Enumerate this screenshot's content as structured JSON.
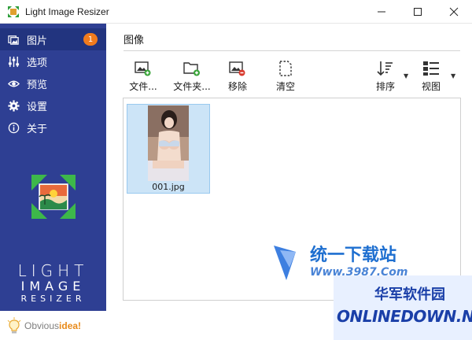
{
  "window": {
    "title": "Light Image Resizer"
  },
  "sidebar": {
    "items": [
      {
        "label": "图片",
        "badge": "1",
        "icon": "images-icon",
        "active": true
      },
      {
        "label": "选项",
        "icon": "sliders-icon"
      },
      {
        "label": "预览",
        "icon": "eye-icon"
      },
      {
        "label": "设置",
        "icon": "gear-icon"
      },
      {
        "label": "关于",
        "icon": "info-icon"
      }
    ],
    "logo": {
      "line1": "LIGHT",
      "line2": "IMAGE",
      "line3": "RESIZER"
    },
    "brand": {
      "prefix": "Obvious",
      "accent": "idea!"
    }
  },
  "main": {
    "section_title": "图像",
    "toolbar": {
      "add_files": "文件...",
      "add_folder": "文件夹...",
      "remove": "移除",
      "clear": "清空",
      "sort": "排序",
      "view": "视图"
    },
    "files": [
      {
        "name": "001.jpg"
      }
    ]
  },
  "watermarks": {
    "site_name": "统一下载站",
    "site_url": "Www.3987.Com",
    "badge_cn": "华军软件园",
    "badge_en": "ONLINEDOWN.NET"
  },
  "colors": {
    "sidebar": "#2e3f93",
    "badge": "#f07b1e",
    "selection": "#cce4f7"
  }
}
